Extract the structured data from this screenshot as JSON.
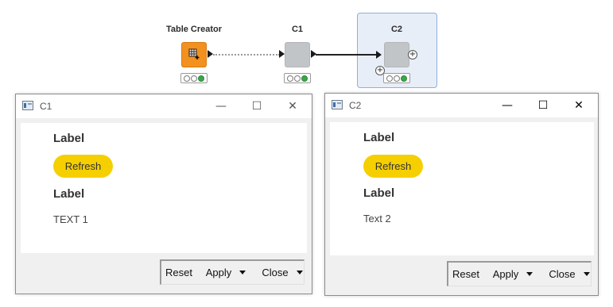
{
  "workflow": {
    "nodes": [
      {
        "title": "Table Creator",
        "status_lights": [
          "off",
          "off",
          "green"
        ]
      },
      {
        "title": "C1",
        "status_lights": [
          "off",
          "off",
          "green"
        ]
      },
      {
        "title": "C2",
        "status_lights": [
          "off",
          "off",
          "green"
        ],
        "selected": true
      }
    ]
  },
  "dialogs": [
    {
      "window_title": "C1",
      "controls": {
        "minimize": "—",
        "maximize": "☐",
        "close": "✕"
      },
      "label_1": "Label",
      "refresh_button": "Refresh",
      "label_2": "Label",
      "text": "TEXT 1",
      "buttons": {
        "reset": "Reset",
        "apply": "Apply",
        "close": "Close"
      }
    },
    {
      "window_title": "C2",
      "controls": {
        "minimize": "—",
        "maximize": "☐",
        "close": "✕"
      },
      "label_1": "Label",
      "refresh_button": "Refresh",
      "label_2": "Label",
      "text": "Text 2",
      "buttons": {
        "reset": "Reset",
        "apply": "Apply",
        "close": "Close"
      }
    }
  ],
  "colors": {
    "source_node": "#f29120",
    "component_node": "#c2c5c8",
    "refresh_button": "#f5cf00",
    "selection": "#e8eef8",
    "status_green": "#3aa64a"
  }
}
